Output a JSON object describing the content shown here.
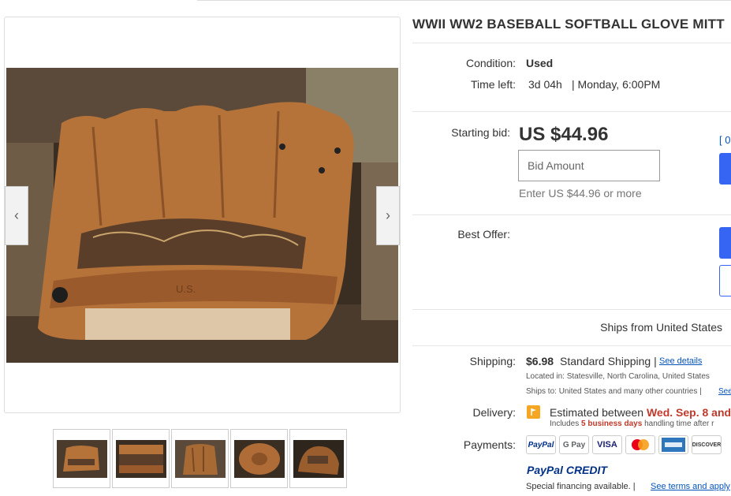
{
  "listing": {
    "title": "WWII WW2 BASEBALL SOFTBALL GLOVE MITT"
  },
  "details": {
    "condition_label": "Condition:",
    "condition_value": "Used",
    "time_left_label": "Time left:",
    "time_left_value": "3d 04h",
    "time_left_end": "| Monday, 6:00PM"
  },
  "bid": {
    "starting_bid_label": "Starting bid:",
    "price": "US $44.96",
    "input_placeholder": "Bid Amount",
    "hint": "Enter US $44.96 or more",
    "bracket_text": "[ 0"
  },
  "offer": {
    "label": "Best Offer:"
  },
  "ships_from": "Ships from United States",
  "shipping": {
    "label": "Shipping:",
    "cost": "$6.98",
    "method": "Standard Shipping |",
    "details_link": "See details",
    "located_in": "Located in:  Statesville, North Carolina, United States",
    "ships_to_prefix": "Ships to:  United States and many other countries |",
    "ships_to_link": "See"
  },
  "delivery": {
    "label": "Delivery:",
    "estimated_prefix": "Estimated between",
    "estimated_date": "Wed. Sep. 8 and",
    "includes_prefix": "Includes",
    "includes_days": "5 business days",
    "includes_suffix": "handling time after r"
  },
  "payments": {
    "label": "Payments:",
    "methods": [
      "PayPal",
      "G Pay",
      "VISA",
      "Mastercard",
      "American Express",
      "DISCOVER"
    ],
    "paypal_credit_1": "PayPal",
    "paypal_credit_2": "CREDIT",
    "financing_text": "Special financing available.  |",
    "financing_link": "See terms and apply"
  },
  "gallery": {
    "prev_glyph": "‹",
    "next_glyph": "›",
    "photo_stamp": "U.S.",
    "thumb_count": 5
  },
  "colors": {
    "accent": "#3665f3",
    "link": "#0654ba",
    "delivery_highlight": "#c0392b",
    "glove_leather": "#b5733a"
  }
}
